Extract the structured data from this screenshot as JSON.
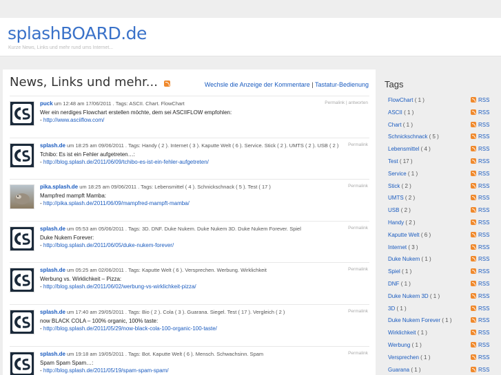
{
  "site": {
    "title": "splashBOARD.de",
    "tagline": "Kurze News, Links und mehr rund ums Internet..."
  },
  "main": {
    "title": "News, Links und mehr...",
    "toggle_comments_link": "Wechsle die Anzeige der Kommentare",
    "separator": "|",
    "keyboard_link": "Tastatur-Bedienung"
  },
  "posts": [
    {
      "avatar": "cs-logo",
      "author": "puck",
      "meta_text": "um 12:48 am 17/06/2011 . Tags: ASCII. Chart. FlowChart",
      "actions": "Permalink | antworten",
      "text": "Wer ein nerdiges Flowchart erstellen möchte, dem sei ASCIIFLOW empfohlen:",
      "link_prefix": "- ",
      "link": "http://www.asciiflow.com/"
    },
    {
      "avatar": "cs-logo",
      "author": "splash.de",
      "meta_text": "um 18:25 am 09/06/2011 . Tags: Handy ( 2 ). Internet ( 3 ). Kaputte Welt ( 6 ). Service. Stick ( 2 ). UMTS ( 2 ). USB ( 2 )",
      "actions": "Permalink",
      "text": "Tchibo: Es ist ein Fehler aufgetreten…:",
      "link_prefix": "- ",
      "link": "http://blog.splash.de/2011/06/09/tchibo-es-ist-ein-fehler-aufgetreten/"
    },
    {
      "avatar": "photo",
      "author": "pika.splash.de",
      "meta_text": "um 18:25 am 09/06/2011 . Tags: Lebensmittel ( 4 ). Schnickschnack ( 5 ). Test ( 17 )",
      "actions": "Permalink",
      "text": "Mampfred mampft Mamba:",
      "link_prefix": "- ",
      "link": "http://pika.splash.de/2011/06/09/mampfred-mampft-mamba/"
    },
    {
      "avatar": "cs-logo",
      "author": "splash.de",
      "meta_text": "um 05:53 am 05/06/2011 . Tags: 3D. DNF. Duke Nukem. Duke Nukem 3D. Duke Nukem Forever. Spiel",
      "actions": "Permalink",
      "text": "Duke Nukem Forever:",
      "link_prefix": "- ",
      "link": "http://blog.splash.de/2011/06/05/duke-nukem-forever/"
    },
    {
      "avatar": "cs-logo",
      "author": "splash.de",
      "meta_text": "um 05:25 am 02/06/2011 . Tags: Kaputte Welt ( 6 ). Versprechen. Werbung. Wirklichkeit",
      "actions": "Permalink",
      "text": "Werbung vs. Wirklichkeit – Pizza:",
      "link_prefix": "- ",
      "link": "http://blog.splash.de/2011/06/02/werbung-vs-wirklichkeit-pizza/"
    },
    {
      "avatar": "cs-logo",
      "author": "splash.de",
      "meta_text": "um 17:40 am 29/05/2011 . Tags: Bio ( 2 ). Cola ( 3 ). Guarana. Siegel. Test ( 17 ). Vergleich ( 2 )",
      "actions": "Permalink",
      "text": "now BLACK COLA – 100% organic, 100% taste:",
      "link_prefix": "- ",
      "link": "http://blog.splash.de/2011/05/29/now-black-cola-100-organic-100-taste/"
    },
    {
      "avatar": "cs-logo",
      "author": "splash.de",
      "meta_text": "um 19:18 am 19/05/2011 . Tags: Bot. Kaputte Welt ( 6 ). Mensch. Schwachsinn. Spam",
      "actions": "Permalink",
      "text": "Spam Spam Spam…:",
      "link_prefix": "- ",
      "link": "http://blog.splash.de/2011/05/19/spam-spam-spam/"
    }
  ],
  "sidebar": {
    "title": "Tags",
    "rss_label": "RSS",
    "tags": [
      {
        "name": "FlowChart",
        "count": "( 1 )"
      },
      {
        "name": "ASCII",
        "count": "( 1 )"
      },
      {
        "name": "Chart",
        "count": "( 1 )"
      },
      {
        "name": "Schnickschnack",
        "count": "( 5 )"
      },
      {
        "name": "Lebensmittel",
        "count": "( 4 )"
      },
      {
        "name": "Test",
        "count": "( 17 )"
      },
      {
        "name": "Service",
        "count": "( 1 )"
      },
      {
        "name": "Stick",
        "count": "( 2 )"
      },
      {
        "name": "UMTS",
        "count": "( 2 )"
      },
      {
        "name": "USB",
        "count": "( 2 )"
      },
      {
        "name": "Handy",
        "count": "( 2 )"
      },
      {
        "name": "Kaputte Welt",
        "count": "( 6 )"
      },
      {
        "name": "Internet",
        "count": "( 3 )"
      },
      {
        "name": "Duke Nukem",
        "count": "( 1 )"
      },
      {
        "name": "Spiel",
        "count": "( 1 )"
      },
      {
        "name": "DNF",
        "count": "( 1 )"
      },
      {
        "name": "Duke Nukem 3D",
        "count": "( 1 )"
      },
      {
        "name": "3D",
        "count": "( 1 )"
      },
      {
        "name": "Duke Nukem Forever",
        "count": "( 1 )"
      },
      {
        "name": "Wirklichkeit",
        "count": "( 1 )"
      },
      {
        "name": "Werbung",
        "count": "( 1 )"
      },
      {
        "name": "Versprechen",
        "count": "( 1 )"
      },
      {
        "name": "Guarana",
        "count": "( 1 )"
      }
    ]
  }
}
